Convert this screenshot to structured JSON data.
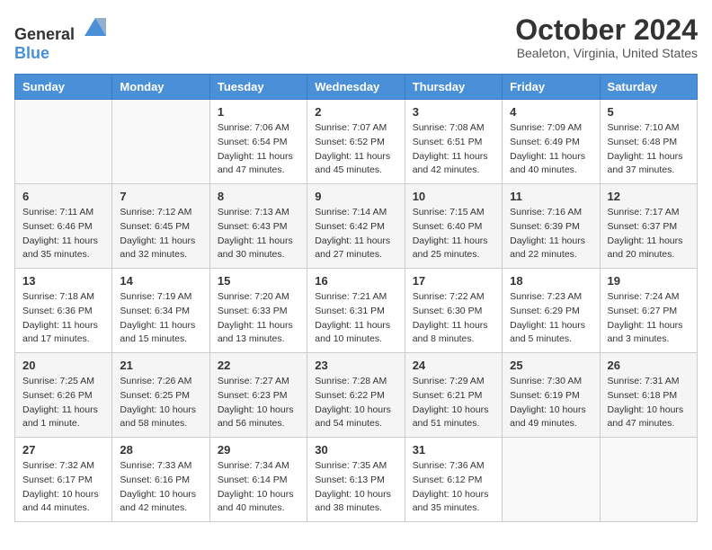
{
  "header": {
    "logo_general": "General",
    "logo_blue": "Blue",
    "month_title": "October 2024",
    "location": "Bealeton, Virginia, United States"
  },
  "calendar": {
    "days_of_week": [
      "Sunday",
      "Monday",
      "Tuesday",
      "Wednesday",
      "Thursday",
      "Friday",
      "Saturday"
    ],
    "weeks": [
      [
        {
          "day": "",
          "empty": true
        },
        {
          "day": "",
          "empty": true
        },
        {
          "day": "1",
          "sunrise": "7:06 AM",
          "sunset": "6:54 PM",
          "daylight": "11 hours and 47 minutes."
        },
        {
          "day": "2",
          "sunrise": "7:07 AM",
          "sunset": "6:52 PM",
          "daylight": "11 hours and 45 minutes."
        },
        {
          "day": "3",
          "sunrise": "7:08 AM",
          "sunset": "6:51 PM",
          "daylight": "11 hours and 42 minutes."
        },
        {
          "day": "4",
          "sunrise": "7:09 AM",
          "sunset": "6:49 PM",
          "daylight": "11 hours and 40 minutes."
        },
        {
          "day": "5",
          "sunrise": "7:10 AM",
          "sunset": "6:48 PM",
          "daylight": "11 hours and 37 minutes."
        }
      ],
      [
        {
          "day": "6",
          "sunrise": "7:11 AM",
          "sunset": "6:46 PM",
          "daylight": "11 hours and 35 minutes."
        },
        {
          "day": "7",
          "sunrise": "7:12 AM",
          "sunset": "6:45 PM",
          "daylight": "11 hours and 32 minutes."
        },
        {
          "day": "8",
          "sunrise": "7:13 AM",
          "sunset": "6:43 PM",
          "daylight": "11 hours and 30 minutes."
        },
        {
          "day": "9",
          "sunrise": "7:14 AM",
          "sunset": "6:42 PM",
          "daylight": "11 hours and 27 minutes."
        },
        {
          "day": "10",
          "sunrise": "7:15 AM",
          "sunset": "6:40 PM",
          "daylight": "11 hours and 25 minutes."
        },
        {
          "day": "11",
          "sunrise": "7:16 AM",
          "sunset": "6:39 PM",
          "daylight": "11 hours and 22 minutes."
        },
        {
          "day": "12",
          "sunrise": "7:17 AM",
          "sunset": "6:37 PM",
          "daylight": "11 hours and 20 minutes."
        }
      ],
      [
        {
          "day": "13",
          "sunrise": "7:18 AM",
          "sunset": "6:36 PM",
          "daylight": "11 hours and 17 minutes."
        },
        {
          "day": "14",
          "sunrise": "7:19 AM",
          "sunset": "6:34 PM",
          "daylight": "11 hours and 15 minutes."
        },
        {
          "day": "15",
          "sunrise": "7:20 AM",
          "sunset": "6:33 PM",
          "daylight": "11 hours and 13 minutes."
        },
        {
          "day": "16",
          "sunrise": "7:21 AM",
          "sunset": "6:31 PM",
          "daylight": "11 hours and 10 minutes."
        },
        {
          "day": "17",
          "sunrise": "7:22 AM",
          "sunset": "6:30 PM",
          "daylight": "11 hours and 8 minutes."
        },
        {
          "day": "18",
          "sunrise": "7:23 AM",
          "sunset": "6:29 PM",
          "daylight": "11 hours and 5 minutes."
        },
        {
          "day": "19",
          "sunrise": "7:24 AM",
          "sunset": "6:27 PM",
          "daylight": "11 hours and 3 minutes."
        }
      ],
      [
        {
          "day": "20",
          "sunrise": "7:25 AM",
          "sunset": "6:26 PM",
          "daylight": "11 hours and 1 minute."
        },
        {
          "day": "21",
          "sunrise": "7:26 AM",
          "sunset": "6:25 PM",
          "daylight": "10 hours and 58 minutes."
        },
        {
          "day": "22",
          "sunrise": "7:27 AM",
          "sunset": "6:23 PM",
          "daylight": "10 hours and 56 minutes."
        },
        {
          "day": "23",
          "sunrise": "7:28 AM",
          "sunset": "6:22 PM",
          "daylight": "10 hours and 54 minutes."
        },
        {
          "day": "24",
          "sunrise": "7:29 AM",
          "sunset": "6:21 PM",
          "daylight": "10 hours and 51 minutes."
        },
        {
          "day": "25",
          "sunrise": "7:30 AM",
          "sunset": "6:19 PM",
          "daylight": "10 hours and 49 minutes."
        },
        {
          "day": "26",
          "sunrise": "7:31 AM",
          "sunset": "6:18 PM",
          "daylight": "10 hours and 47 minutes."
        }
      ],
      [
        {
          "day": "27",
          "sunrise": "7:32 AM",
          "sunset": "6:17 PM",
          "daylight": "10 hours and 44 minutes."
        },
        {
          "day": "28",
          "sunrise": "7:33 AM",
          "sunset": "6:16 PM",
          "daylight": "10 hours and 42 minutes."
        },
        {
          "day": "29",
          "sunrise": "7:34 AM",
          "sunset": "6:14 PM",
          "daylight": "10 hours and 40 minutes."
        },
        {
          "day": "30",
          "sunrise": "7:35 AM",
          "sunset": "6:13 PM",
          "daylight": "10 hours and 38 minutes."
        },
        {
          "day": "31",
          "sunrise": "7:36 AM",
          "sunset": "6:12 PM",
          "daylight": "10 hours and 35 minutes."
        },
        {
          "day": "",
          "empty": true
        },
        {
          "day": "",
          "empty": true
        }
      ]
    ]
  },
  "labels": {
    "sunrise": "Sunrise:",
    "sunset": "Sunset:",
    "daylight": "Daylight:"
  }
}
